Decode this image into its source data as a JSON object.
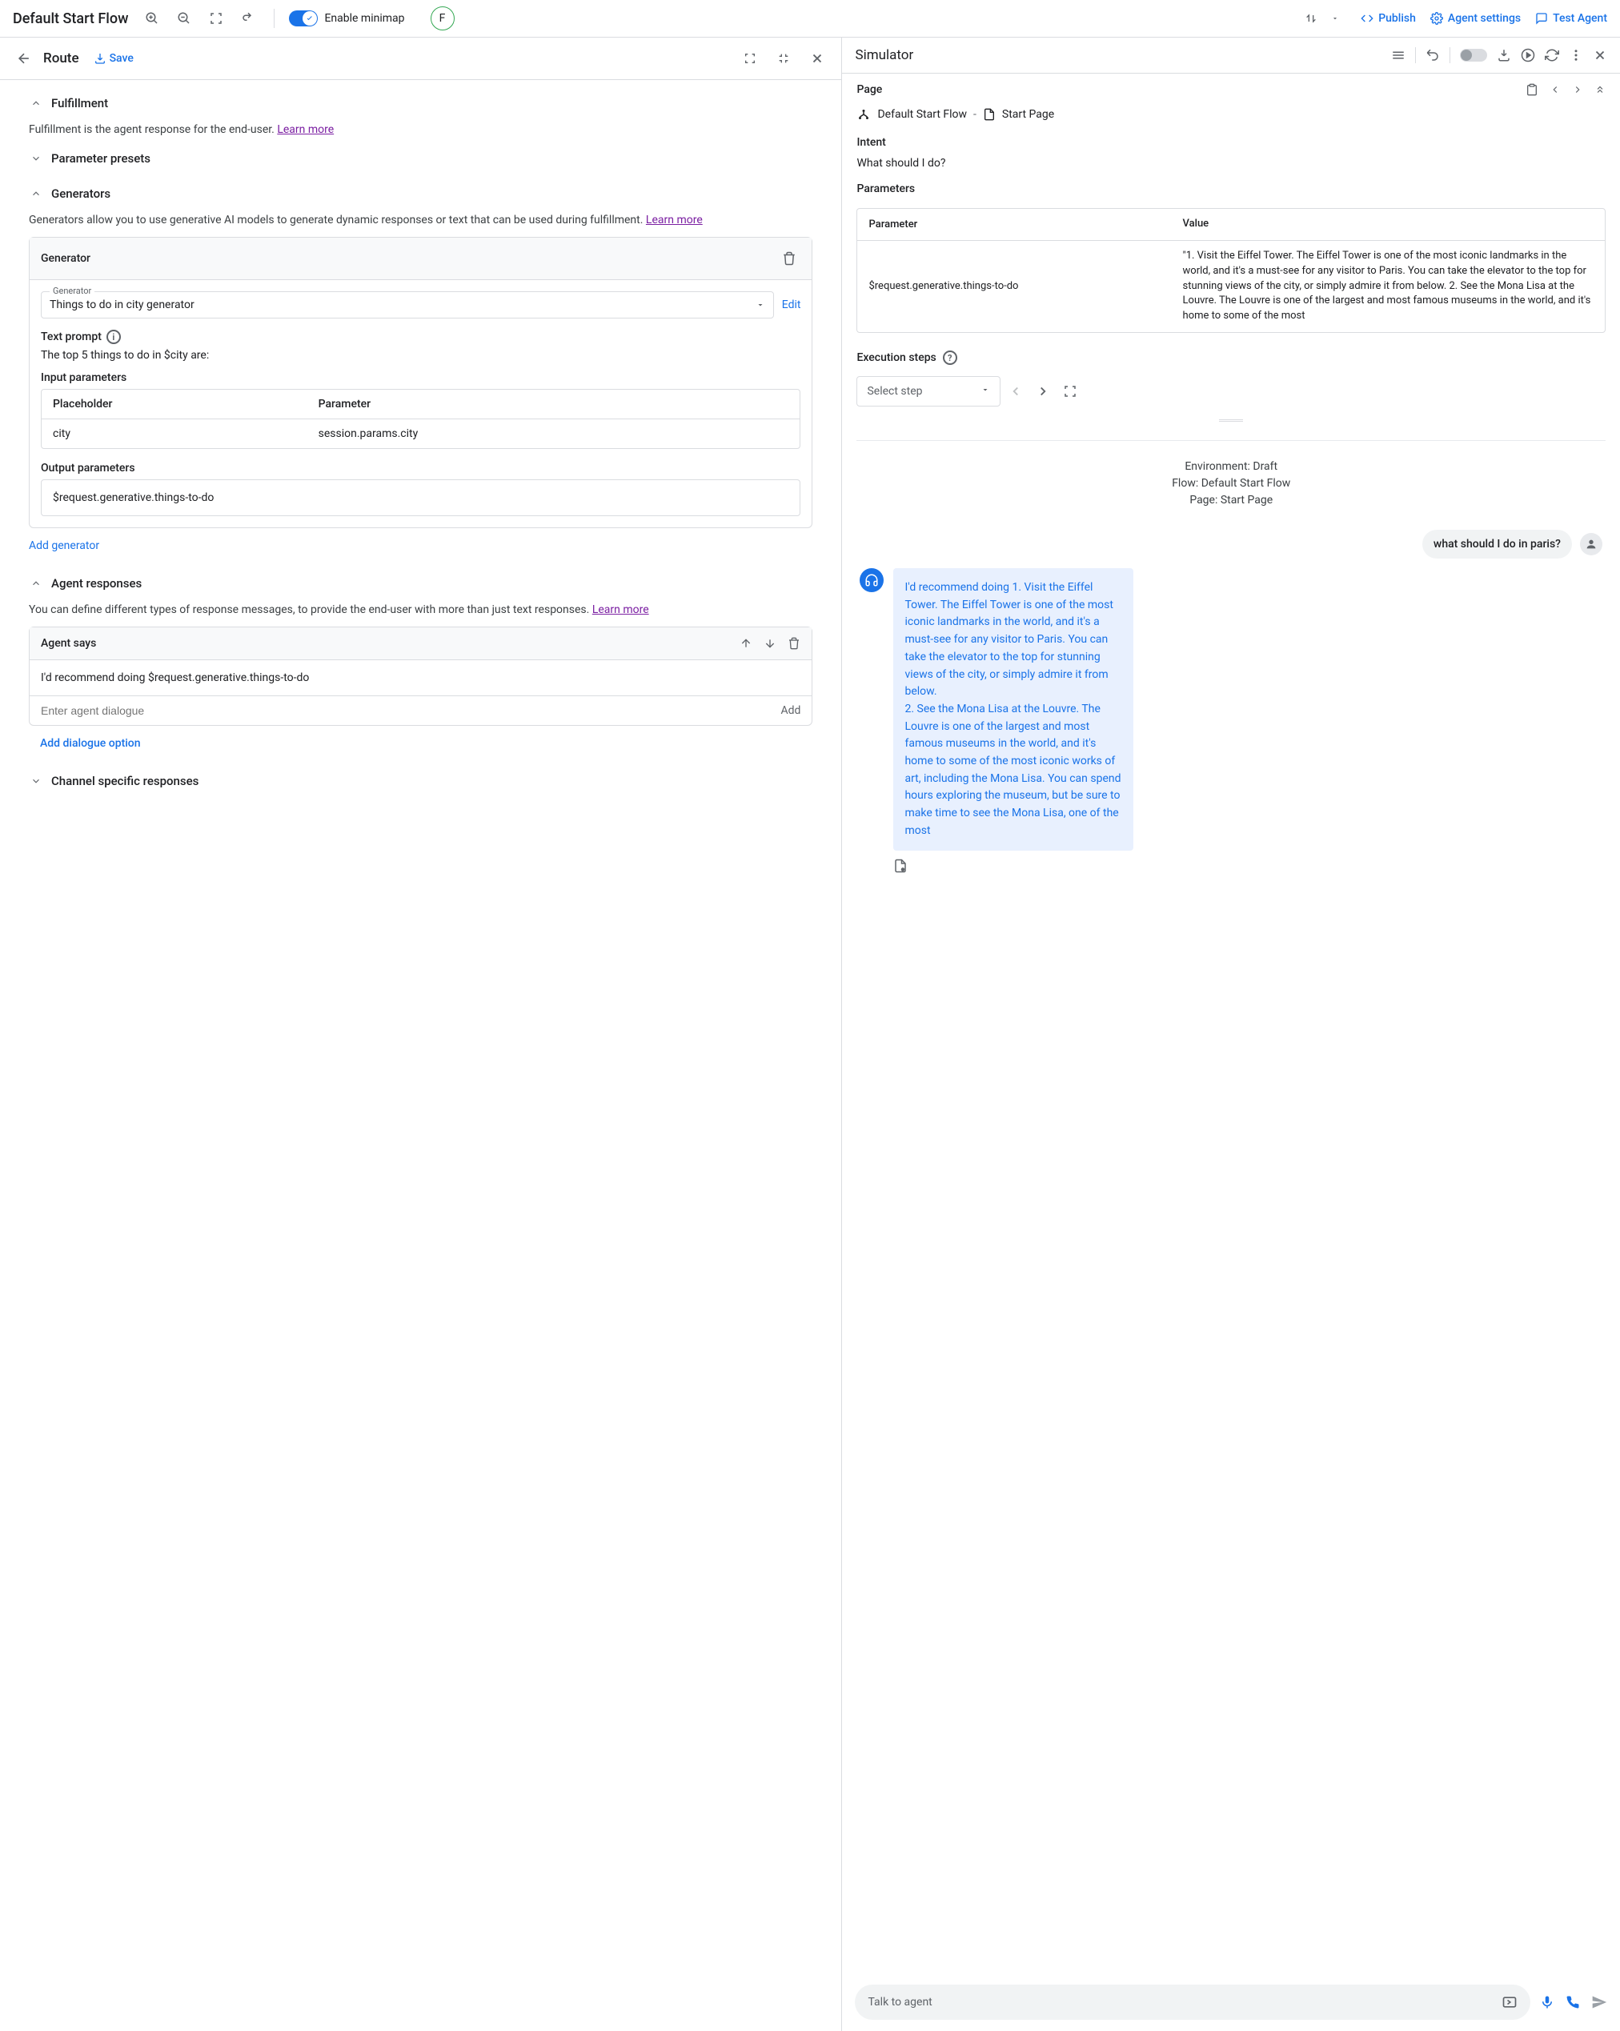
{
  "topbar": {
    "title": "Default Start Flow",
    "minimap_label": "Enable minimap",
    "avatar_letter": "F",
    "publish": "Publish",
    "agent_settings": "Agent settings",
    "test_agent": "Test Agent"
  },
  "route": {
    "title": "Route",
    "save": "Save"
  },
  "fulfillment": {
    "title": "Fulfillment",
    "desc": "Fulfillment is the agent response for the end-user. ",
    "learn": "Learn more"
  },
  "param_presets": {
    "title": "Parameter presets"
  },
  "generators": {
    "title": "Generators",
    "desc1": "Generators allow you to use generative AI models to generate dynamic responses or text that can be used during fulfillment. ",
    "learn": "Learn more",
    "card_title": "Generator",
    "dropdown_label": "Generator",
    "dropdown_value": "Things to do in city generator",
    "edit": "Edit",
    "text_prompt_label": "Text prompt",
    "text_prompt": "The top 5 things to do in $city are:",
    "input_params_label": "Input parameters",
    "col_placeholder": "Placeholder",
    "col_parameter": "Parameter",
    "row_placeholder": "city",
    "row_parameter": "session.params.city",
    "output_params_label": "Output parameters",
    "output_value": "$request.generative.things-to-do",
    "add_generator": "Add generator"
  },
  "agent_responses": {
    "title": "Agent responses",
    "desc": "You can define different types of response messages, to provide the end-user with more than just text responses. ",
    "learn": "Learn more",
    "card_title": "Agent says",
    "dialogue1": "I'd recommend doing  $request.generative.things-to-do",
    "placeholder": "Enter agent dialogue",
    "add_inline": "Add",
    "add_option": "Add dialogue option"
  },
  "channel_specific": {
    "title": "Channel specific responses"
  },
  "simulator": {
    "title": "Simulator",
    "page_label": "Page",
    "bc_flow": "Default Start Flow",
    "bc_page": "Start Page",
    "intent_label": "Intent",
    "intent_value": "What should I do?",
    "params_label": "Parameters",
    "param_col1": "Parameter",
    "param_col2": "Value",
    "param_name": "$request.generative.things-to-do",
    "param_value": "\"1. Visit the Eiffel Tower. The Eiffel Tower is one of the most iconic landmarks in the world, and it's a must-see for any visitor to Paris. You can take the elevator to the top for stunning views of the city, or simply admire it from below. 2. See the Mona Lisa at the Louvre. The Louvre is one of the largest and most famous museums in the world, and it's home to some of the most",
    "exec_label": "Execution steps",
    "select_step": "Select step",
    "env_line1": "Environment: Draft",
    "env_line2": "Flow: Default Start Flow",
    "env_line3": "Page: Start Page",
    "user_msg": "what should I do in paris?",
    "bot_msg": "I'd recommend doing 1. Visit the Eiffel Tower. The Eiffel Tower is one of the most iconic landmarks in the world, and it's a must-see for any visitor to Paris. You can take the elevator to the top for stunning views of the city, or simply admire it from below.\n2. See the Mona Lisa at the Louvre. The Louvre is one of the largest and most famous museums in the world, and it's home to some of the most iconic works of art, including the Mona Lisa. You can spend hours exploring the museum, but be sure to make time to see the Mona Lisa, one of the most",
    "talk_placeholder": "Talk to agent"
  }
}
